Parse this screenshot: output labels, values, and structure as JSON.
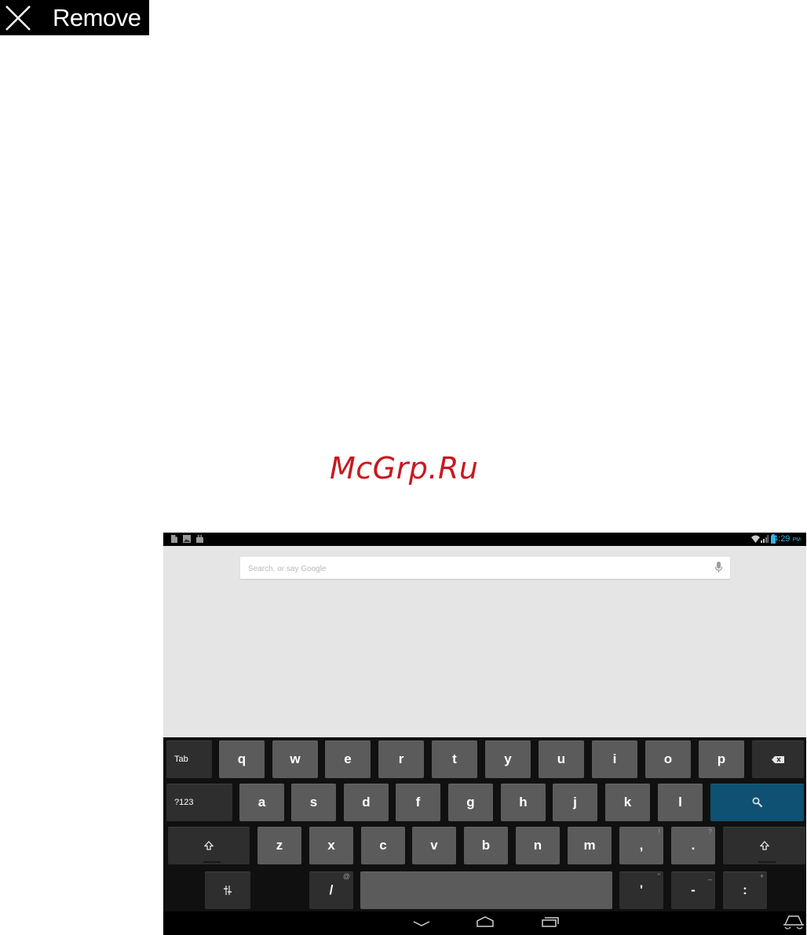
{
  "remove_bar": {
    "label": "Remove",
    "icon": "close-icon"
  },
  "watermark": "McGrp.Ru",
  "status_bar": {
    "time": "4:29",
    "ampm": "PM",
    "time_color": "#33b5e5",
    "left_icons": [
      "document-icon",
      "image-icon",
      "bag-icon"
    ],
    "right_icons": [
      "wifi-icon",
      "signal-icon",
      "battery-icon"
    ]
  },
  "search": {
    "placeholder": "Search, or say Google",
    "value": "",
    "icon": "mic-icon"
  },
  "keyboard": {
    "rows": [
      [
        {
          "id": "tab",
          "label": "Tab",
          "style": "dark"
        },
        {
          "id": "q",
          "label": "q"
        },
        {
          "id": "w",
          "label": "w"
        },
        {
          "id": "e",
          "label": "e"
        },
        {
          "id": "r",
          "label": "r"
        },
        {
          "id": "t",
          "label": "t"
        },
        {
          "id": "y",
          "label": "y"
        },
        {
          "id": "u",
          "label": "u"
        },
        {
          "id": "i",
          "label": "i"
        },
        {
          "id": "o",
          "label": "o"
        },
        {
          "id": "p",
          "label": "p"
        },
        {
          "id": "backspace",
          "label": "",
          "icon": "backspace-icon",
          "style": "dark"
        }
      ],
      [
        {
          "id": "symbols",
          "label": "?123",
          "style": "dark"
        },
        {
          "id": "a",
          "label": "a"
        },
        {
          "id": "s",
          "label": "s"
        },
        {
          "id": "d",
          "label": "d"
        },
        {
          "id": "f",
          "label": "f"
        },
        {
          "id": "g",
          "label": "g"
        },
        {
          "id": "h",
          "label": "h"
        },
        {
          "id": "j",
          "label": "j"
        },
        {
          "id": "k",
          "label": "k"
        },
        {
          "id": "l",
          "label": "l"
        },
        {
          "id": "search",
          "label": "",
          "icon": "search-icon",
          "style": "blue"
        }
      ],
      [
        {
          "id": "shift-left",
          "label": "",
          "icon": "shift-icon",
          "style": "dark"
        },
        {
          "id": "z",
          "label": "z"
        },
        {
          "id": "x",
          "label": "x"
        },
        {
          "id": "c",
          "label": "c"
        },
        {
          "id": "v",
          "label": "v"
        },
        {
          "id": "b",
          "label": "b"
        },
        {
          "id": "n",
          "label": "n"
        },
        {
          "id": "m",
          "label": "m"
        },
        {
          "id": "comma",
          "label": ",",
          "hint": "!"
        },
        {
          "id": "period",
          "label": ".",
          "hint": "?"
        },
        {
          "id": "shift-right",
          "label": "",
          "icon": "shift-icon",
          "style": "dark"
        }
      ],
      [
        {
          "id": "settings",
          "label": "",
          "icon": "settings-sliders-icon",
          "style": "dark"
        },
        {
          "id": "slash",
          "label": "/",
          "hint": "@",
          "style": "dark"
        },
        {
          "id": "space",
          "label": ""
        },
        {
          "id": "apostrophe",
          "label": "'",
          "hint": "\"",
          "style": "dark"
        },
        {
          "id": "dash",
          "label": "-",
          "hint": "_",
          "style": "dark"
        },
        {
          "id": "colon",
          "label": ":",
          "hint": "+",
          "style": "dark"
        }
      ]
    ]
  },
  "nav_bar": {
    "buttons": [
      "back-icon",
      "home-icon",
      "recent-apps-icon"
    ],
    "extra": "keyboard-switch-icon"
  }
}
